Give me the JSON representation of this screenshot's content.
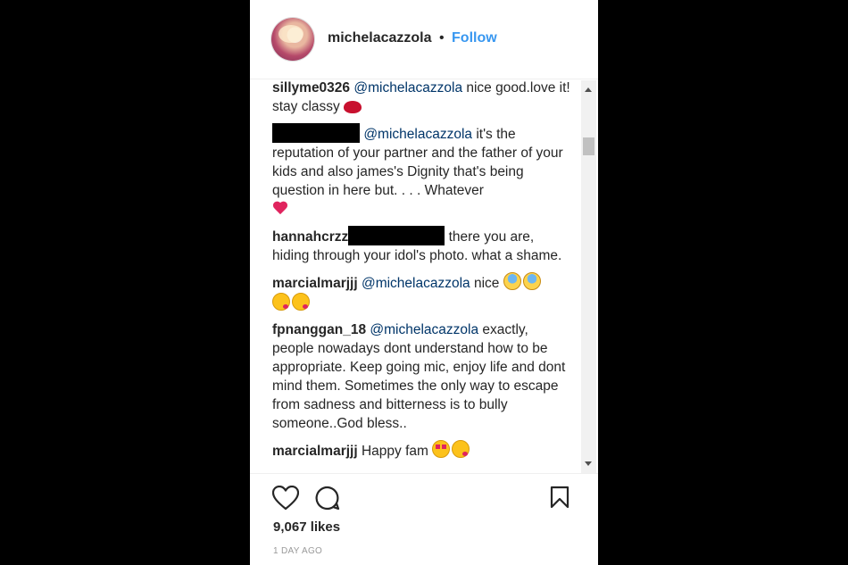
{
  "post": {
    "username": "michelacazzola",
    "separator": "•",
    "follow_label": "Follow"
  },
  "comments": [
    {
      "user": "sillyme0326",
      "mention": "@michelacazzola",
      "text": " nice good.love it! stay classy",
      "emoji": "kiss-lips"
    },
    {
      "user": "",
      "redacted": true,
      "mention": "@michelacazzola",
      "text": " it's the reputation of your partner and the father of your kids and also james's Dignity that's being question in here but. . . . Whatever",
      "emoji": "two-hearts"
    },
    {
      "user": "hannahcrzz",
      "redacted": true,
      "text": " there you are, hiding through your idol's photo. what a shame."
    },
    {
      "user": "marcialmarjjj",
      "mention": "@michelacazzola",
      "text": " nice",
      "emoji": "sweat-face, kiss-face"
    },
    {
      "user": "fpnanggan_18",
      "mention": "@michelacazzola",
      "text": " exactly, people nowadays dont understand how to be appropriate. Keep going mic, enjoy life and dont mind them. Sometimes the only way to escape from sadness and bitterness is to bully someone..God bless.."
    },
    {
      "user": "marcialmarjjj",
      "text": "Happy fam",
      "emoji": "heart-eyes-face, kiss-face"
    }
  ],
  "actions": {
    "like_icon": "heart-icon",
    "comment_icon": "comment-icon",
    "save_icon": "bookmark-icon"
  },
  "likes": "9,067 likes",
  "timestamp": "1 DAY AGO",
  "colors": {
    "follow": "#3897f0",
    "mention": "#003569",
    "text": "#262626",
    "muted": "#999999"
  }
}
